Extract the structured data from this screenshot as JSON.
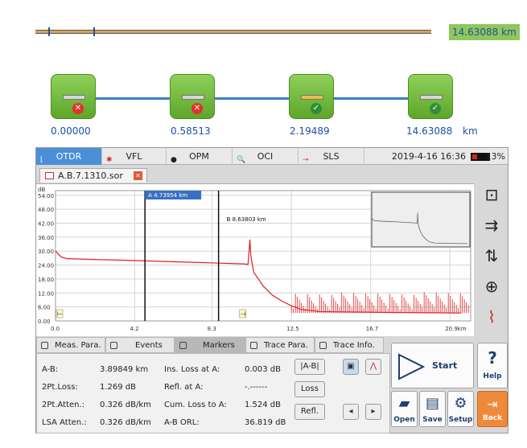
{
  "span": {
    "total_label": "14.63088 km"
  },
  "events": [
    {
      "value": "0.00000",
      "status": "fail",
      "icon": "connector-icon"
    },
    {
      "value": "0.58513",
      "status": "fail",
      "icon": "splice-icon"
    },
    {
      "value": "2.19489",
      "status": "pass",
      "icon": "reflective-event-icon"
    },
    {
      "value": "14.63088",
      "status": "pass",
      "icon": "fiber-end-icon"
    }
  ],
  "events_unit": "km",
  "tabs": [
    {
      "label": "OTDR",
      "icon": "otdr-icon",
      "active": true
    },
    {
      "label": "VFL",
      "icon": "laser-icon",
      "active": false
    },
    {
      "label": "OPM",
      "icon": "dot-icon",
      "active": false
    },
    {
      "label": "OCI",
      "icon": "microscope-icon",
      "active": false
    },
    {
      "label": "SLS",
      "icon": "light-source-icon",
      "active": false
    }
  ],
  "status": {
    "datetime": "2019-4-16 16:36",
    "battery": "13%"
  },
  "file": {
    "name": "A.B.7.1310.sor"
  },
  "chart_data": {
    "type": "line",
    "ylabel": "dB",
    "xunit": "km",
    "xlim": [
      0,
      22
    ],
    "ylim": [
      0,
      56
    ],
    "x_ticks": [
      "0.0",
      "4.2",
      "8.3",
      "12.5",
      "16.7",
      "20.9km"
    ],
    "y_ticks": [
      "0.00",
      "6.00",
      "12.00",
      "18.00",
      "24.00",
      "30.00",
      "36.00",
      "42.00",
      "48.00",
      "54.00"
    ],
    "series": [
      {
        "x": [
          0.0,
          0.3,
          0.6,
          2.0,
          4.0,
          6.0,
          8.0,
          10.0,
          10.2,
          10.3,
          10.35,
          10.5,
          11.0,
          11.5,
          12.0,
          12.5,
          13.0,
          14.0,
          16.0,
          18.0,
          20.0,
          21.5
        ],
        "y": [
          30,
          27.5,
          26.8,
          26.4,
          26.0,
          25.5,
          25.0,
          24.5,
          24.3,
          35.0,
          28.0,
          21.0,
          15.0,
          11.0,
          8.5,
          6.5,
          5.0,
          4.0,
          3.8,
          3.6,
          3.5,
          3.4
        ]
      }
    ],
    "markers": [
      {
        "label": "A 4.73954 km",
        "x": 4.74
      },
      {
        "label": "B 8.63803 km",
        "x": 8.64
      }
    ],
    "flags": [
      "⊢",
      "⊣"
    ],
    "colors": {
      "trace": "#e02020",
      "marker": "#111111",
      "marker_label_bg": "#3a6fc4"
    }
  },
  "side_tools": [
    "zoom-full-icon",
    "zoom-horizontal-icon",
    "zoom-vertical-icon",
    "zoom-in-icon",
    "event-view-icon"
  ],
  "panel_tabs": [
    {
      "label": "Meas. Para.",
      "active": false
    },
    {
      "label": "Events",
      "active": false
    },
    {
      "label": "Markers",
      "active": true
    },
    {
      "label": "Trace Para.",
      "active": false
    },
    {
      "label": "Trace Info.",
      "active": false
    }
  ],
  "markers_panel": {
    "rows": [
      {
        "l1": "A-B:",
        "v1": "3.89849 km",
        "l2": "Ins. Loss at A:",
        "v2": "0.003 dB"
      },
      {
        "l1": "2Pt.Loss:",
        "v1": "1.269 dB",
        "l2": "Refl. at A:",
        "v2": "-.------"
      },
      {
        "l1": "2Pt.Atten.:",
        "v1": "0.326 dB/km",
        "l2": "Cum. Loss to A:",
        "v2": "1.524 dB"
      },
      {
        "l1": "LSA Atten.:",
        "v1": "0.326 dB/km",
        "l2": "A-B ORL:",
        "v2": "36.819 dB"
      }
    ],
    "buttons": {
      "ab": "|A-B|",
      "loss": "Loss",
      "refl": "Refl."
    }
  },
  "actions": {
    "start": "Start",
    "help_glyph": "?",
    "help": "Help",
    "open": "Open",
    "save": "Save",
    "setup": "Setup",
    "back": "Back"
  }
}
